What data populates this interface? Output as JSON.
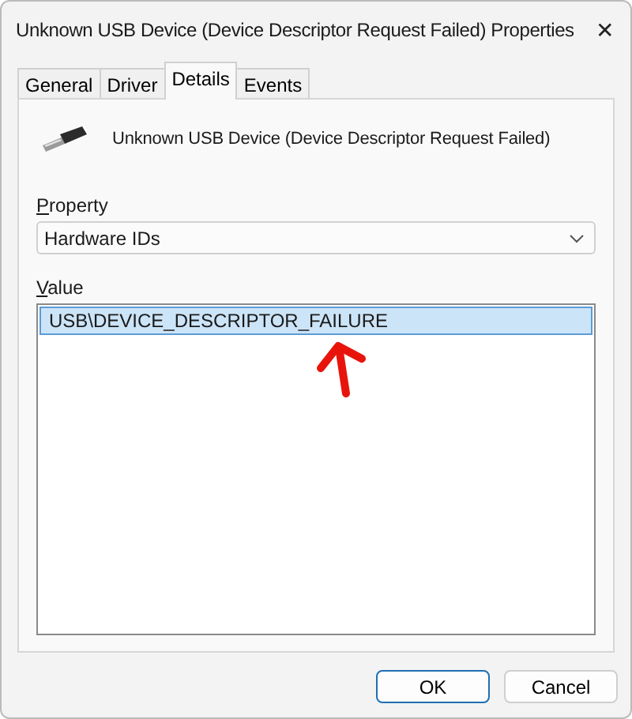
{
  "window": {
    "title": "Unknown USB Device (Device Descriptor Request Failed) Properties",
    "close": "✕"
  },
  "tabs": [
    {
      "label": "General",
      "selected": false
    },
    {
      "label": "Driver",
      "selected": false
    },
    {
      "label": "Details",
      "selected": true
    },
    {
      "label": "Events",
      "selected": false
    }
  ],
  "device": {
    "name": "Unknown USB Device (Device Descriptor Request Failed)"
  },
  "property": {
    "label": "Property",
    "value": "Hardware IDs"
  },
  "value": {
    "label": "Value",
    "items": [
      {
        "text": "USB\\DEVICE_DESCRIPTOR_FAILURE",
        "selected": true
      }
    ]
  },
  "buttons": [
    {
      "label": "OK",
      "kind": "default"
    },
    {
      "label": "Cancel",
      "kind": "normal"
    }
  ]
}
